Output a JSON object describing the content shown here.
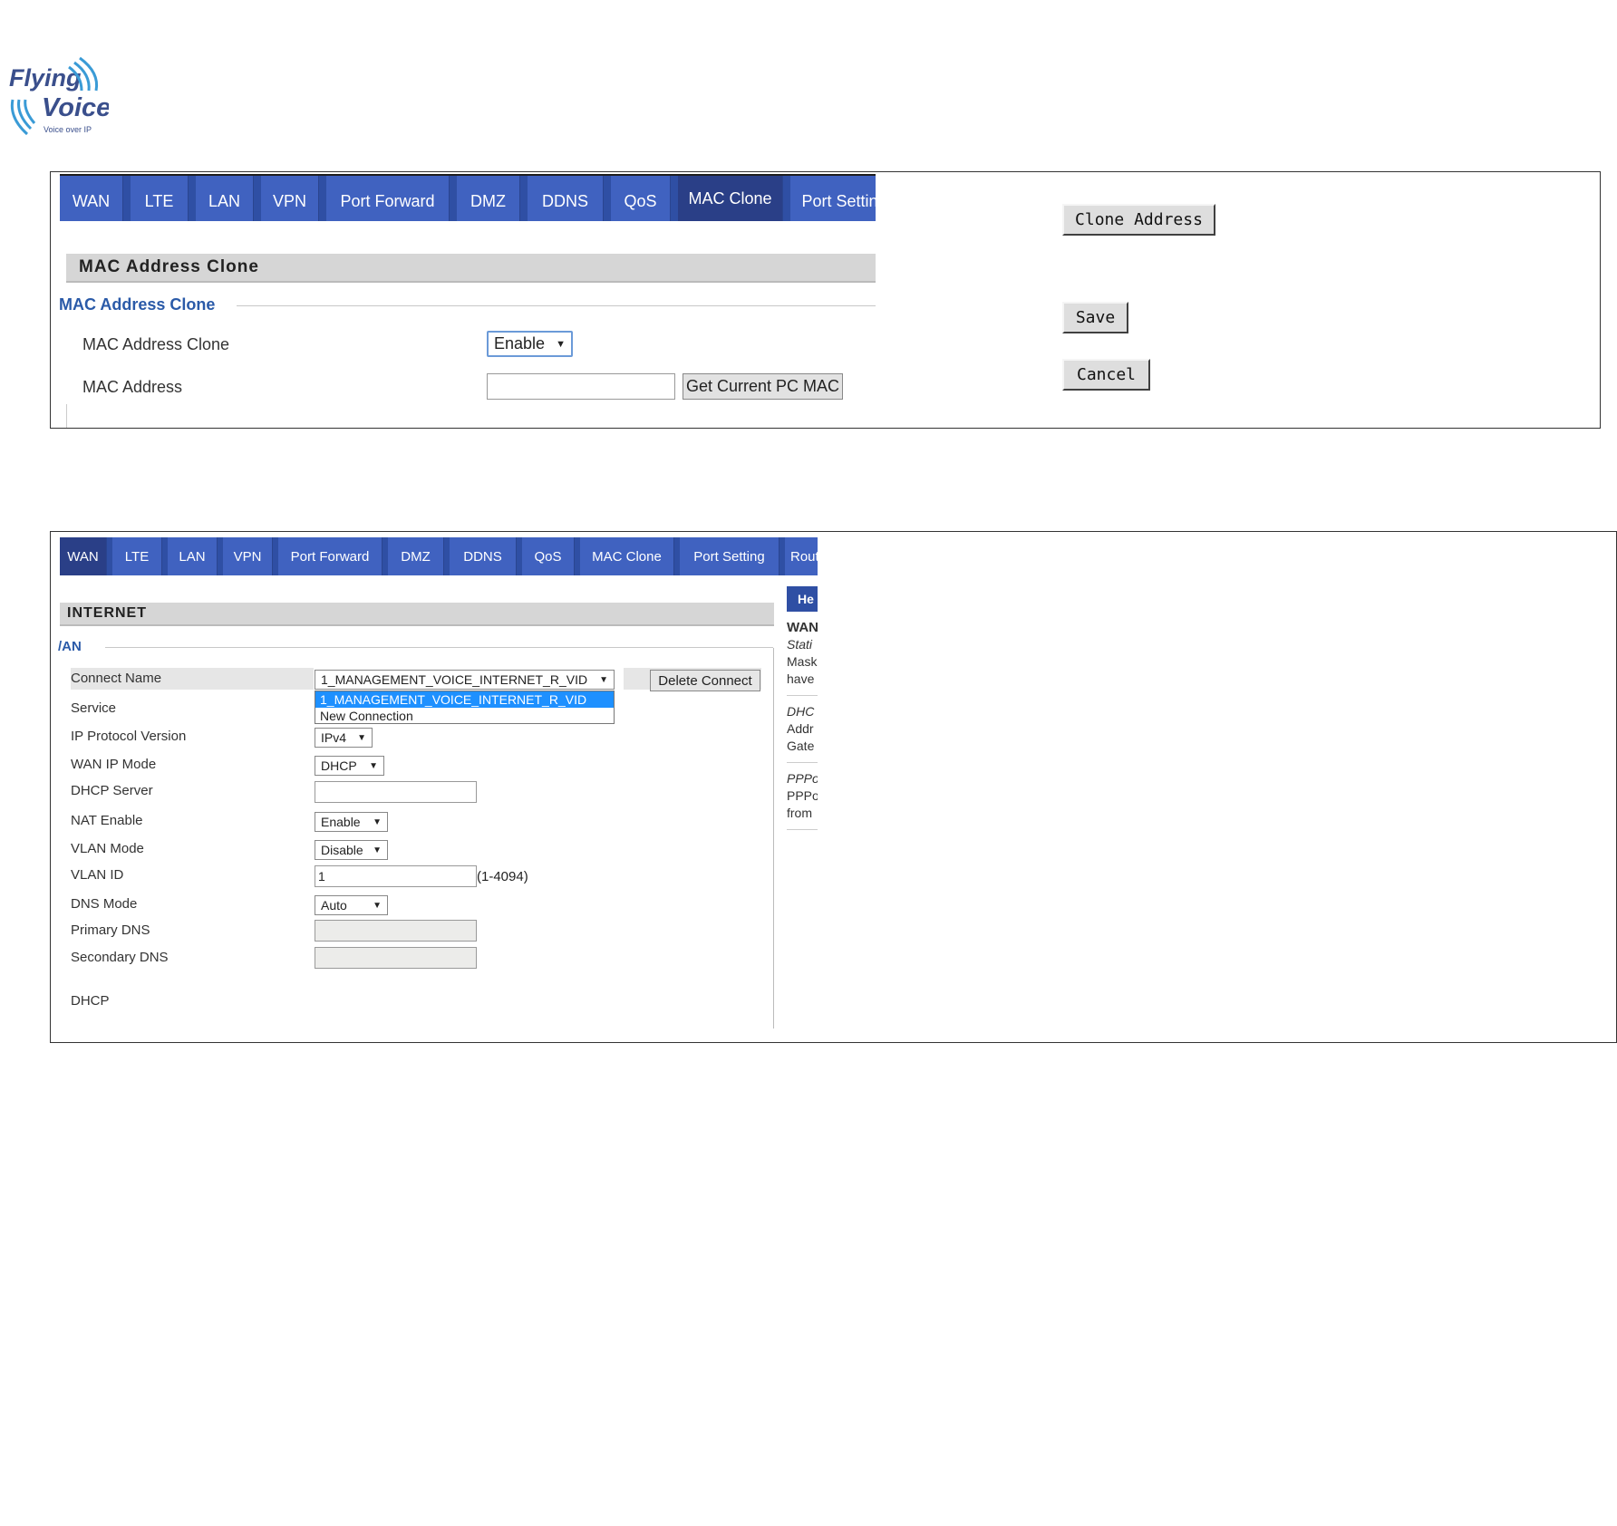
{
  "logo": {
    "line1": "Flying",
    "line2": "Voice",
    "tagline": "Voice over IP",
    "brand_color": "#3a4f8c",
    "wave_color": "#3a9bd6"
  },
  "screenshot1": {
    "tabs": [
      "WAN",
      "LTE",
      "LAN",
      "VPN",
      "Port Forward",
      "DMZ",
      "DDNS",
      "QoS",
      "MAC Clone",
      "Port Setting"
    ],
    "active_tab": "MAC Clone",
    "section_header": "MAC Address Clone",
    "legend": "MAC Address Clone",
    "fields": {
      "clone_label": "MAC Address Clone",
      "clone_value": "Enable",
      "mac_label": "MAC Address",
      "mac_value": "",
      "get_mac_button": "Get Current PC MAC"
    },
    "side_buttons": {
      "clone": "Clone Address",
      "save": "Save",
      "cancel": "Cancel"
    }
  },
  "screenshot2": {
    "tabs": [
      "WAN",
      "LTE",
      "LAN",
      "VPN",
      "Port Forward",
      "DMZ",
      "DDNS",
      "QoS",
      "MAC Clone",
      "Port Setting",
      "Rout"
    ],
    "active_tab": "WAN",
    "section_header": "INTERNET",
    "legend": "/AN",
    "rows": {
      "connect_name_label": "Connect Name",
      "connect_name_value": "1_MANAGEMENT_VOICE_INTERNET_R_VID",
      "delete_button": "Delete Connect",
      "dropdown_options": [
        "1_MANAGEMENT_VOICE_INTERNET_R_VID",
        "New Connection"
      ],
      "service_label": "Service",
      "ip_protocol_label": "IP Protocol Version",
      "ip_protocol_value": "IPv4",
      "wan_ip_mode_label": "WAN IP Mode",
      "wan_ip_mode_value": "DHCP",
      "dhcp_server_label": "DHCP Server",
      "dhcp_server_value": "",
      "nat_enable_label": "NAT Enable",
      "nat_enable_value": "Enable",
      "vlan_mode_label": "VLAN Mode",
      "vlan_mode_value": "Disable",
      "vlan_id_label": "VLAN ID",
      "vlan_id_value": "1",
      "vlan_id_range": "(1-4094)",
      "dns_mode_label": "DNS Mode",
      "dns_mode_value": "Auto",
      "primary_dns_label": "Primary DNS",
      "secondary_dns_label": "Secondary DNS",
      "dhcp_label": "DHCP"
    },
    "help": {
      "title": "He",
      "wan": "WAN",
      "lines1": [
        "Stati",
        "Mask",
        "have"
      ],
      "lines2": [
        "DHC",
        "Addr",
        "Gate"
      ],
      "lines3": [
        "PPPo",
        "PPPo",
        "from"
      ]
    }
  }
}
